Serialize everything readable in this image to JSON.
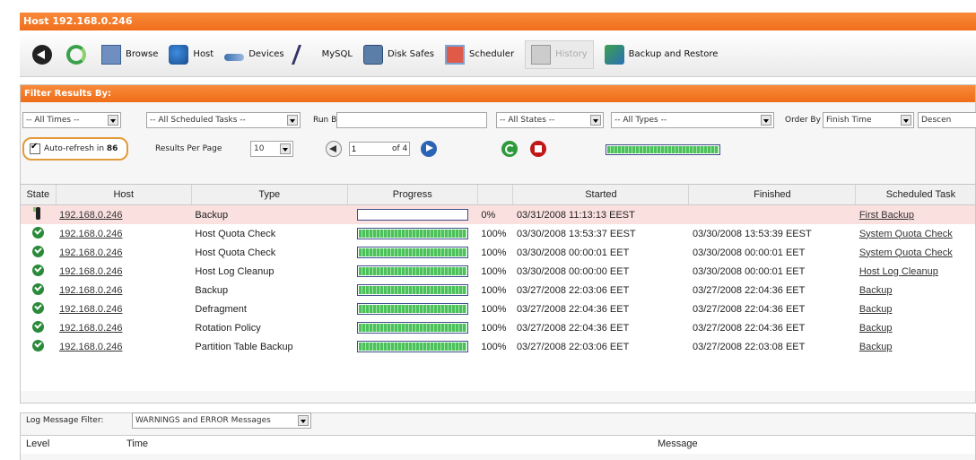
{
  "window": {
    "title": "Host 192.168.0.246"
  },
  "toolbar": {
    "items": [
      {
        "label": "Browse",
        "icon": "browse-icon"
      },
      {
        "label": "Host",
        "icon": "host-icon"
      },
      {
        "label": "Devices",
        "icon": "devices-icon"
      },
      {
        "label": "MySQL",
        "icon": "mysql-icon"
      },
      {
        "label": "Disk Safes",
        "icon": "disk-safes-icon"
      },
      {
        "label": "Scheduler",
        "icon": "scheduler-icon"
      },
      {
        "label": "History",
        "icon": "history-icon"
      },
      {
        "label": "Backup and Restore",
        "icon": "backup-restore-icon"
      }
    ]
  },
  "filter": {
    "heading": "Filter Results By:",
    "times": "-- All Times --",
    "scheduled_tasks": "-- All Scheduled Tasks --",
    "run_by_label": "Run By",
    "run_by_value": "",
    "states": "-- All States --",
    "types": "-- All Types --",
    "order_by_label": "Order By",
    "order_by_value": "Finish Time",
    "order_dir": "Descen",
    "auto_refresh_label": "Auto-refresh in",
    "auto_refresh_seconds": "86",
    "results_per_page_label": "Results Per Page",
    "results_per_page": "10",
    "page_current": "1",
    "page_total": "of 4",
    "overall_progress": 1.0
  },
  "table": {
    "columns": [
      "State",
      "Host",
      "Type",
      "Progress",
      "",
      "Started",
      "Finished",
      "Scheduled Task"
    ],
    "rows": [
      {
        "state": "running",
        "host": "192.168.0.246",
        "type": "Backup",
        "progress": 0,
        "percent": "0%",
        "started": "03/31/2008 11:13:13 EEST",
        "finished": "",
        "task": "First Backup",
        "extra": "a"
      },
      {
        "state": "ok",
        "host": "192.168.0.246",
        "type": "Host Quota Check",
        "progress": 1,
        "percent": "100%",
        "started": "03/30/2008 13:53:37 EEST",
        "finished": "03/30/2008 13:53:39 EEST",
        "task": "System Quota Check",
        "extra": "S"
      },
      {
        "state": "ok",
        "host": "192.168.0.246",
        "type": "Host Quota Check",
        "progress": 1,
        "percent": "100%",
        "started": "03/30/2008 00:00:01 EET",
        "finished": "03/30/2008 00:00:01 EET",
        "task": "System Quota Check",
        "extra": "S"
      },
      {
        "state": "ok",
        "host": "192.168.0.246",
        "type": "Host Log Cleanup",
        "progress": 1,
        "percent": "100%",
        "started": "03/30/2008 00:00:00 EET",
        "finished": "03/30/2008 00:00:01 EET",
        "task": "Host Log Cleanup",
        "extra": "a"
      },
      {
        "state": "ok",
        "host": "192.168.0.246",
        "type": "Backup",
        "progress": 1,
        "percent": "100%",
        "started": "03/27/2008 22:03:06 EET",
        "finished": "03/27/2008 22:04:36 EET",
        "task": "Backup",
        "extra": "a"
      },
      {
        "state": "ok",
        "host": "192.168.0.246",
        "type": "Defragment",
        "progress": 1,
        "percent": "100%",
        "started": "03/27/2008 22:04:36 EET",
        "finished": "03/27/2008 22:04:36 EET",
        "task": "Backup",
        "extra": "a"
      },
      {
        "state": "ok",
        "host": "192.168.0.246",
        "type": "Rotation Policy",
        "progress": 1,
        "percent": "100%",
        "started": "03/27/2008 22:04:36 EET",
        "finished": "03/27/2008 22:04:36 EET",
        "task": "Backup",
        "extra": "a"
      },
      {
        "state": "ok",
        "host": "192.168.0.246",
        "type": "Partition Table Backup",
        "progress": 1,
        "percent": "100%",
        "started": "03/27/2008 22:03:06 EET",
        "finished": "03/27/2008 22:03:08 EET",
        "task": "Backup",
        "extra": "a"
      }
    ]
  },
  "log": {
    "filter_label": "Log Message Filter:",
    "filter_value": "WARNINGS and ERROR Messages",
    "columns": [
      "Level",
      "Time",
      "Message"
    ]
  },
  "colors": {
    "accent": "#f06e1a",
    "ok": "#2a8a3a",
    "progress": "#4cc15a"
  }
}
